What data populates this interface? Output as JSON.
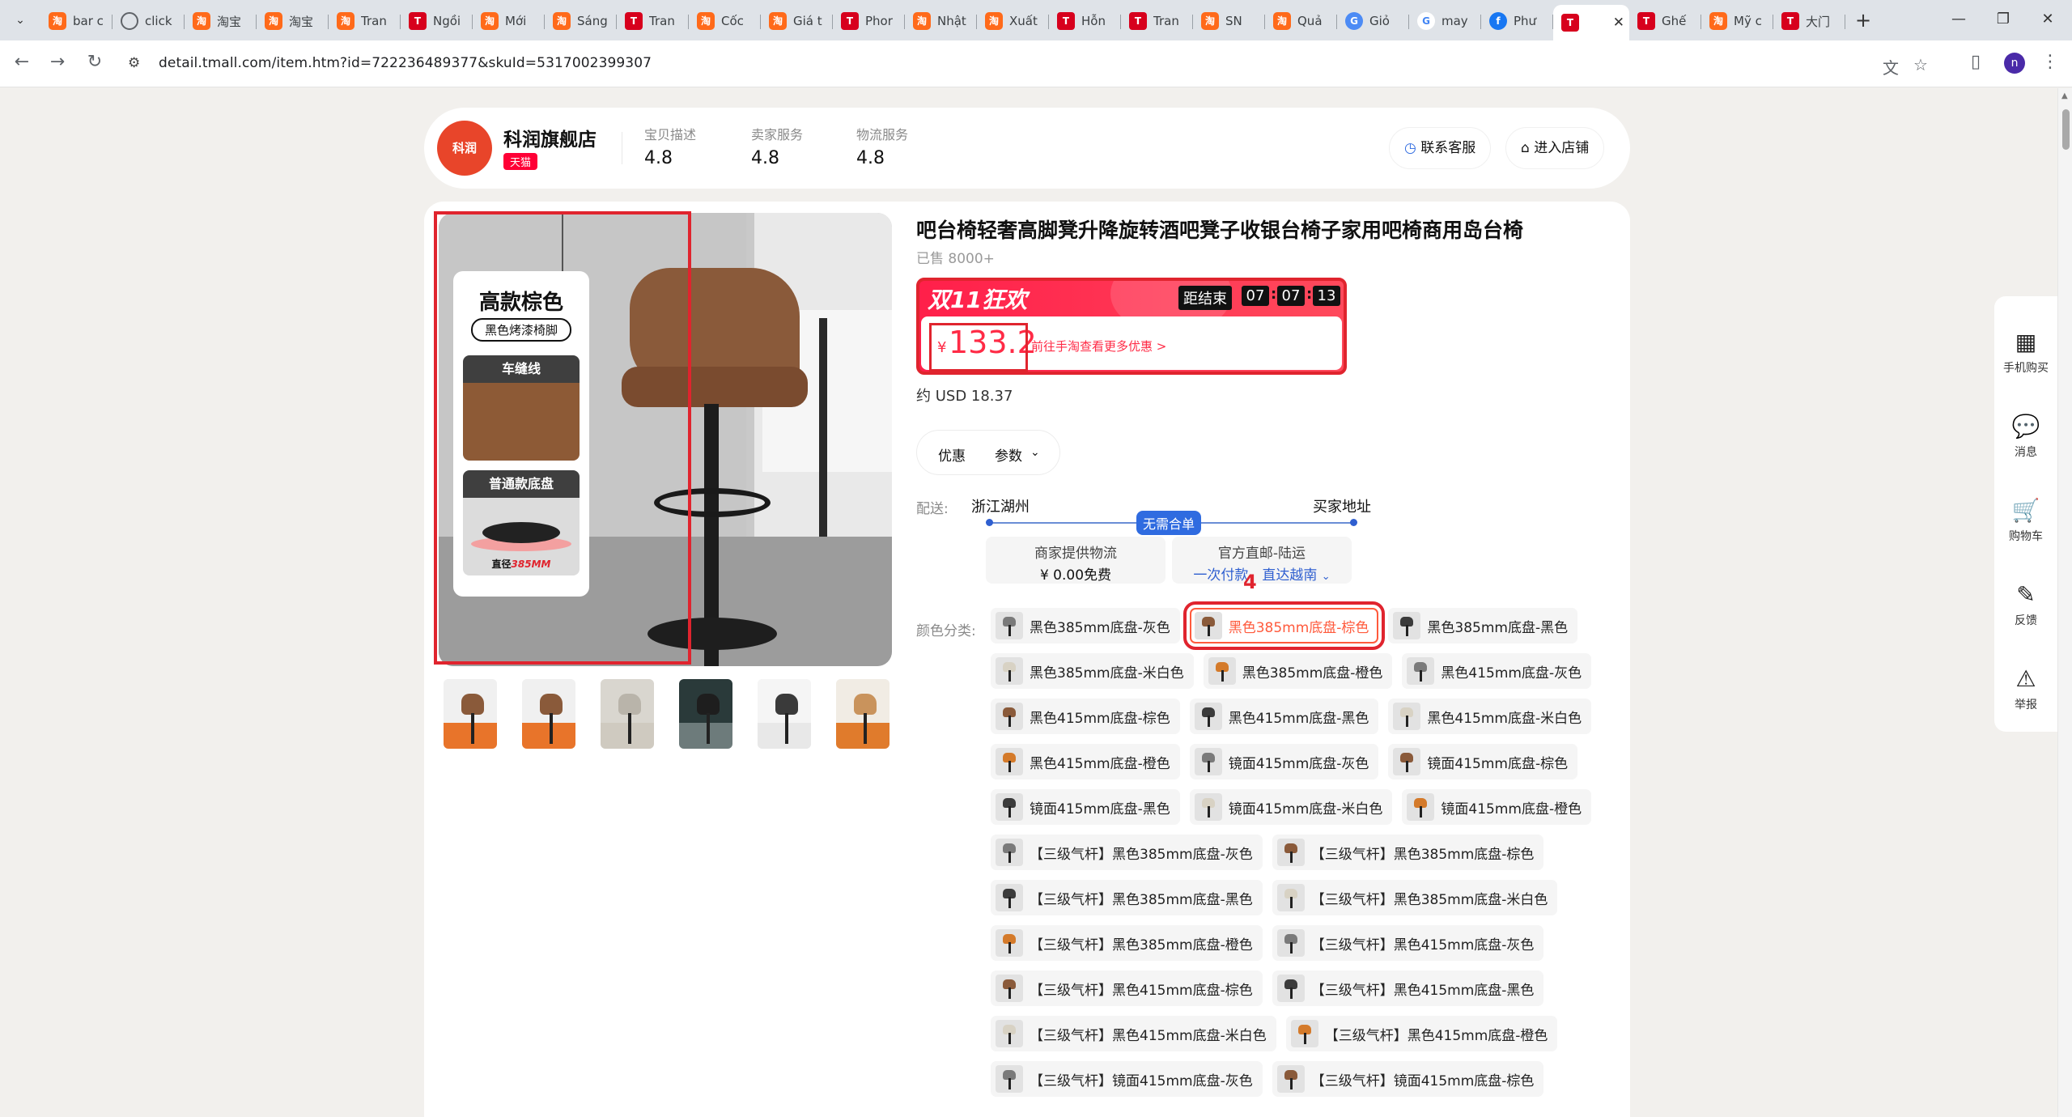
{
  "browser": {
    "tabs": [
      {
        "title": "bar c",
        "icon": "taobao"
      },
      {
        "title": "click",
        "icon": "globe"
      },
      {
        "title": "淘宝",
        "icon": "taobao"
      },
      {
        "title": "淘宝",
        "icon": "taobao"
      },
      {
        "title": "Tran",
        "icon": "taobao"
      },
      {
        "title": "Ngồi",
        "icon": "tmall"
      },
      {
        "title": "Mới",
        "icon": "taobao"
      },
      {
        "title": "Sáng",
        "icon": "taobao"
      },
      {
        "title": "Tran",
        "icon": "tmall"
      },
      {
        "title": "Cốc",
        "icon": "taobao"
      },
      {
        "title": "Giá t",
        "icon": "taobao"
      },
      {
        "title": "Phor",
        "icon": "tmall"
      },
      {
        "title": "Nhật",
        "icon": "taobao"
      },
      {
        "title": "Xuất",
        "icon": "taobao"
      },
      {
        "title": "Hỗn",
        "icon": "tmall"
      },
      {
        "title": "Tran",
        "icon": "tmall"
      },
      {
        "title": "SN",
        "icon": "taobao"
      },
      {
        "title": "Quả",
        "icon": "taobao"
      },
      {
        "title": "Giỏ",
        "icon": "gtrans"
      },
      {
        "title": "may",
        "icon": "google"
      },
      {
        "title": "Phư",
        "icon": "facebook"
      },
      {
        "title": "",
        "icon": "tmall",
        "active": true
      },
      {
        "title": "Ghế",
        "icon": "tmall"
      },
      {
        "title": "Mỹ c",
        "icon": "taobao"
      },
      {
        "title": "大门",
        "icon": "tmall"
      }
    ],
    "active_tab_close": "✕",
    "new_tab": "+",
    "url": "detail.tmall.com/item.htm?id=722236489377&skuId=5317002399307",
    "profile_initial": "n"
  },
  "shop": {
    "logo_text": "科润",
    "name": "科润旗舰店",
    "tag": "天猫",
    "scores": [
      {
        "label": "宝贝描述",
        "value": "4.8"
      },
      {
        "label": "卖家服务",
        "value": "4.8"
      },
      {
        "label": "物流服务",
        "value": "4.8"
      }
    ],
    "contact_btn": "联系客服",
    "enter_btn": "进入店铺"
  },
  "gallery": {
    "info_title": "高款棕色",
    "info_pill": "黑色烤漆椅脚",
    "swatch1_label": "车缝线",
    "swatch2_label": "普通款底盘",
    "diameter_prefix": "直径",
    "diameter_value": "385MM",
    "thumb_count": 6
  },
  "product": {
    "title": "吧台椅轻奢高脚凳升降旋转酒吧凳子收银台椅子家用吧椅商用岛台椅",
    "sold": "已售 8000+",
    "promo_logo": "双11狂欢",
    "countdown_label": "距结束",
    "countdown": {
      "h": "07",
      "m": "07",
      "s": "13"
    },
    "currency": "¥",
    "price": "133.2",
    "promo_link": "前往手淘查看更多优惠 >",
    "usd": "约 USD 18.37",
    "tab_offers": "优惠",
    "tab_params": "参数",
    "ship_label": "配送:",
    "ship_from": "浙江湖州",
    "ship_to": "买家地址",
    "ship_badge": "无需合单",
    "ship_options": [
      {
        "line1": "商家提供物流",
        "line2": "¥ 0.00免费"
      },
      {
        "line1": "官方直邮-陆运",
        "line2": "一次付款，直达越南"
      }
    ],
    "color_label": "颜色分类:",
    "annotation_number": "4",
    "sku_rows": [
      [
        "黑色385mm底盘-灰色",
        "黑色385mm底盘-棕色",
        "黑色385mm底盘-黑色"
      ],
      [
        "黑色385mm底盘-米白色",
        "黑色385mm底盘-橙色",
        "黑色415mm底盘-灰色"
      ],
      [
        "黑色415mm底盘-棕色",
        "黑色415mm底盘-黑色",
        "黑色415mm底盘-米白色"
      ],
      [
        "黑色415mm底盘-橙色",
        "镜面415mm底盘-灰色",
        "镜面415mm底盘-棕色"
      ],
      [
        "镜面415mm底盘-黑色",
        "镜面415mm底盘-米白色",
        "镜面415mm底盘-橙色"
      ],
      [
        "【三级气杆】黑色385mm底盘-灰色",
        "【三级气杆】黑色385mm底盘-棕色"
      ],
      [
        "【三级气杆】黑色385mm底盘-黑色",
        "【三级气杆】黑色385mm底盘-米白色"
      ],
      [
        "【三级气杆】黑色385mm底盘-橙色",
        "【三级气杆】黑色415mm底盘-灰色"
      ],
      [
        "【三级气杆】黑色415mm底盘-棕色",
        "【三级气杆】黑色415mm底盘-黑色"
      ],
      [
        "【三级气杆】黑色415mm底盘-米白色",
        "【三级气杆】黑色415mm底盘-橙色"
      ],
      [
        "【三级气杆】镜面415mm底盘-灰色",
        "【三级气杆】镜面415mm底盘-棕色"
      ]
    ],
    "selected_sku": "黑色385mm底盘-棕色"
  },
  "sidetool": [
    {
      "label": "手机购买",
      "icon": "qr-code-icon"
    },
    {
      "label": "消息",
      "icon": "chat-icon"
    },
    {
      "label": "购物车",
      "icon": "cart-icon"
    },
    {
      "label": "反馈",
      "icon": "edit-icon"
    },
    {
      "label": "举报",
      "icon": "warning-icon"
    }
  ],
  "colors": {
    "tmall_red": "#ff0036",
    "price_red": "#ff2b46",
    "annotation_red": "#e0242e",
    "selected_orange": "#ff5a3c"
  }
}
